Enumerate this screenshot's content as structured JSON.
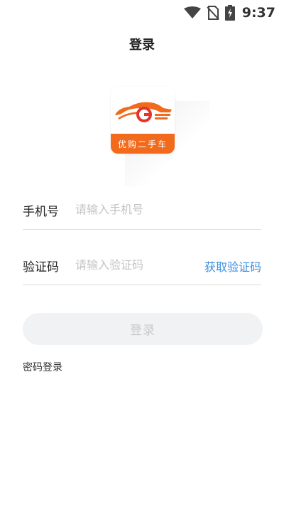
{
  "status_bar": {
    "time": "9:37",
    "icons": [
      "wifi-icon",
      "no-sim-icon",
      "battery-charging-icon"
    ]
  },
  "header": {
    "title": "登录"
  },
  "logo": {
    "text": "优购二手车",
    "colors": {
      "brand_orange": "#f26a1b",
      "brand_red": "#e5322d"
    }
  },
  "form": {
    "phone": {
      "label": "手机号",
      "placeholder": "请输入手机号",
      "value": ""
    },
    "code": {
      "label": "验证码",
      "placeholder": "请输入验证码",
      "value": "",
      "get_code_label": "获取验证码"
    },
    "submit_label": "登录",
    "password_login_label": "密码登录"
  },
  "colors": {
    "link": "#3b8de0",
    "button_bg_disabled": "#f1f2f4",
    "button_text_disabled": "#c9c9c9"
  }
}
